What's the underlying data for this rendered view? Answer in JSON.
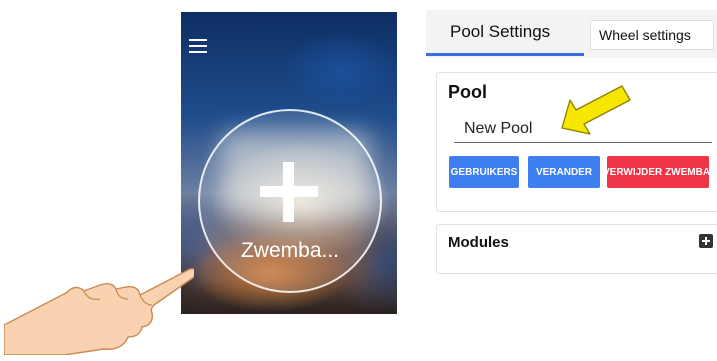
{
  "app": {
    "menu_icon": "hamburger-icon",
    "add_icon": "plus-icon",
    "pool_tile_name": "Zwemba..."
  },
  "settings": {
    "tabs": [
      {
        "label": "Pool Settings",
        "active": true
      },
      {
        "label": "Wheel settings",
        "active": false
      }
    ],
    "pool": {
      "heading": "Pool",
      "name_value": "New Pool"
    },
    "buttons": {
      "users": "GEBRUIKERS",
      "change": "VERANDER",
      "delete": "VERWIJDER ZWEMBAD"
    },
    "modules": {
      "label": "Modules",
      "add_icon": "plus-square-icon"
    }
  },
  "annotations": {
    "pointer": "pointing-hand-icon",
    "arrow": "arrow-icon",
    "arrow_color": "#f7e600"
  },
  "colors": {
    "primary_button": "#3d7ef0",
    "danger_button": "#ee3445",
    "tab_indicator": "#3b6fe0"
  }
}
